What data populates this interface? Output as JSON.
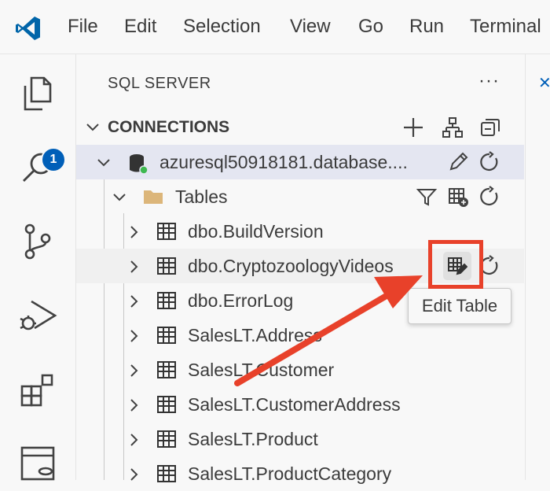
{
  "menu": {
    "items": [
      "File",
      "Edit",
      "Selection",
      "View",
      "Go",
      "Run",
      "Terminal"
    ]
  },
  "activity_bar": {
    "explorer_badge": "1",
    "icons": [
      "explorer-icon",
      "search-icon",
      "source-control-icon",
      "run-debug-icon",
      "extensions-icon",
      "sql-server-icon"
    ]
  },
  "sidebar": {
    "title": "SQL SERVER",
    "more_label": "···",
    "connections": {
      "header": "CONNECTIONS",
      "server": "azuresql50918181.database....",
      "tables_folder": "Tables",
      "tables": [
        "dbo.BuildVersion",
        "dbo.CryptozoologyVideos",
        "dbo.ErrorLog",
        "SalesLT.Address",
        "SalesLT.Customer",
        "SalesLT.CustomerAddress",
        "SalesLT.Product",
        "SalesLT.ProductCategory"
      ]
    }
  },
  "tooltip": {
    "text": "Edit Table"
  },
  "colors": {
    "accent": "#005fb8",
    "highlight": "#e8412a",
    "selected_row": "#e4e6f1",
    "folder": "#dcb67a"
  }
}
